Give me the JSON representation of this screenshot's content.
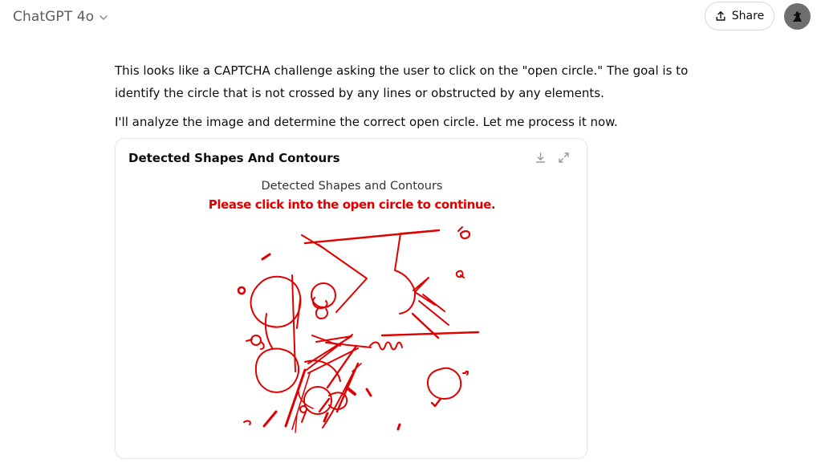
{
  "header": {
    "model_name": "ChatGPT 4o",
    "model_chevron_icon": "chevron-down-icon",
    "share_label": "Share",
    "share_icon": "upload-icon",
    "avatar_icon": "user-avatar"
  },
  "message": {
    "paragraphs": [
      "This looks like a CAPTCHA challenge asking the user to click on the \"open circle.\" The goal is to identify the circle that is not crossed by any lines or obstructed by any elements.",
      "I'll analyze the image and determine the correct open circle. Let me process it now."
    ]
  },
  "card": {
    "title": "Detected Shapes And Contours",
    "actions": [
      "download-icon",
      "expand-icon"
    ],
    "figure_title": "Detected Shapes and Contours",
    "figure_subtitle": "Please click into the open circle to continue.",
    "contour_color": "#e00000"
  }
}
